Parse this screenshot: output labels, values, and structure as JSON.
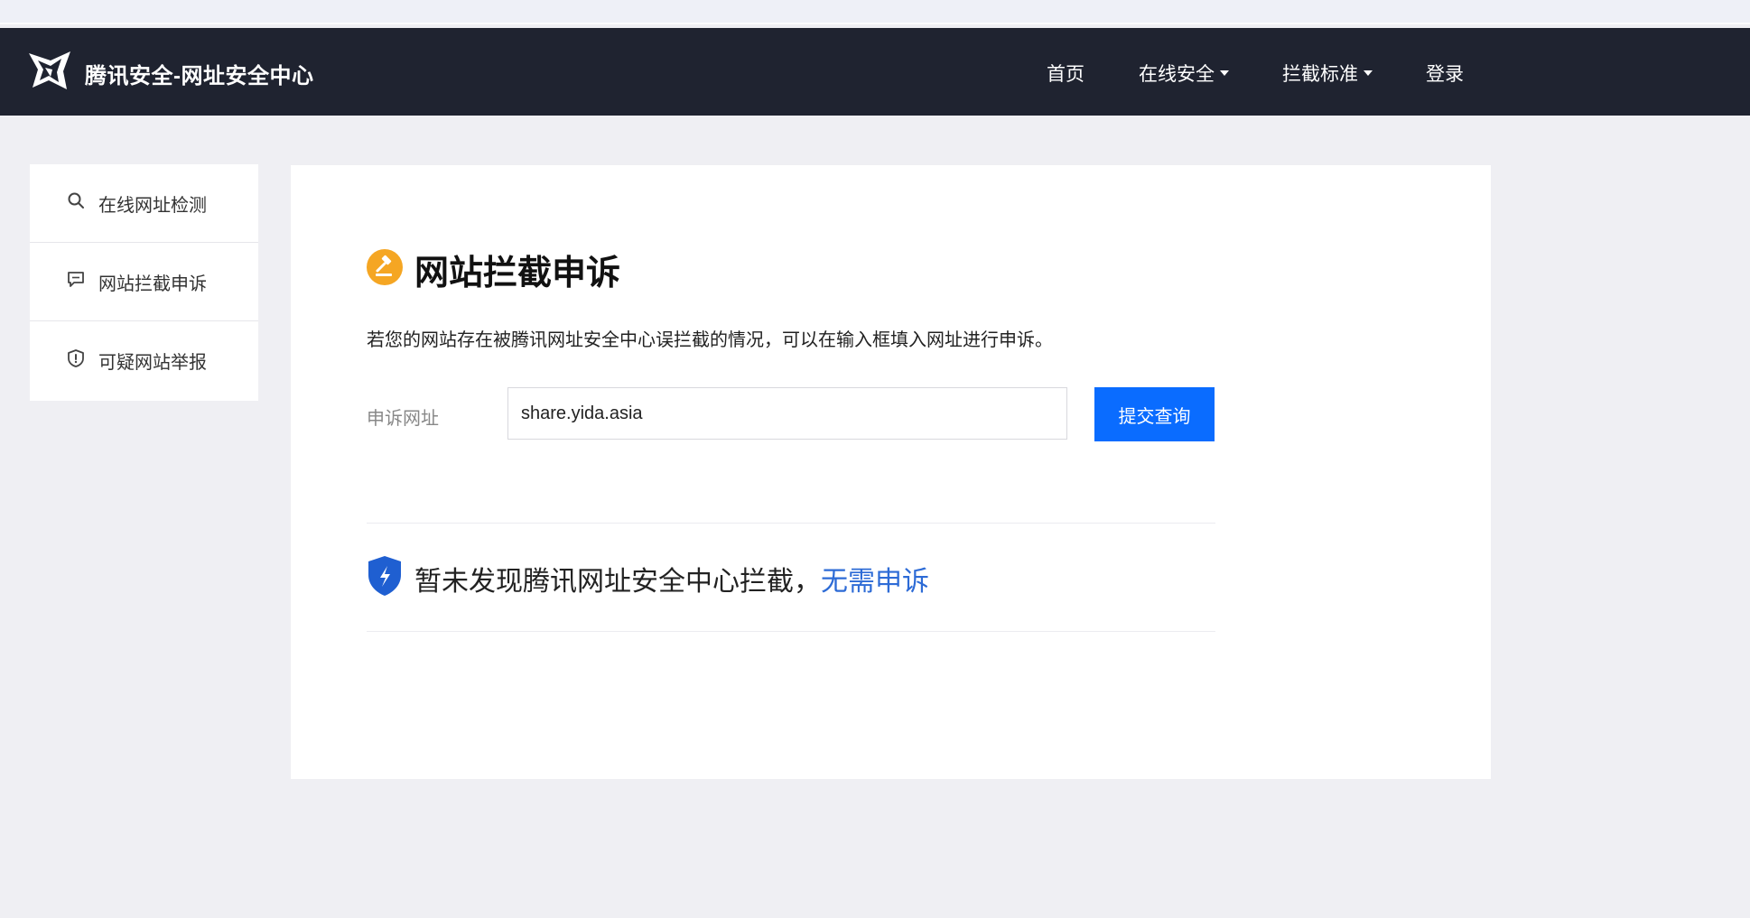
{
  "colors": {
    "nav_bg": "#1f2330",
    "page_bg": "#efeff3",
    "primary": "#0a6cff",
    "link": "#2d6bd6",
    "title_icon": "#f5a623",
    "shield_icon": "#1f5fd1"
  },
  "header": {
    "logo_icon": "tencent-security-logo-icon",
    "title": "腾讯安全-网址安全中心",
    "nav": [
      {
        "label": "首页"
      },
      {
        "label": "在线安全",
        "dropdown": true
      },
      {
        "label": "拦截标准",
        "dropdown": true
      },
      {
        "label": "登录"
      }
    ]
  },
  "sidebar": {
    "items": [
      {
        "label": "在线网址检测",
        "icon": "search-icon"
      },
      {
        "label": "网站拦截申诉",
        "icon": "message-icon"
      },
      {
        "label": "可疑网站举报",
        "icon": "shield-alert-icon"
      }
    ]
  },
  "main": {
    "title_icon": "gavel-icon",
    "title": "网站拦截申诉",
    "description": "若您的网站存在被腾讯网址安全中心误拦截的情况，可以在输入框填入网址进行申诉。",
    "form": {
      "label": "申诉网址",
      "value": "share.yida.asia",
      "submit_label": "提交查询"
    },
    "result": {
      "icon": "shield-check-icon",
      "text": "暂未发现腾讯网址安全中心拦截，",
      "link": "无需申诉"
    }
  }
}
